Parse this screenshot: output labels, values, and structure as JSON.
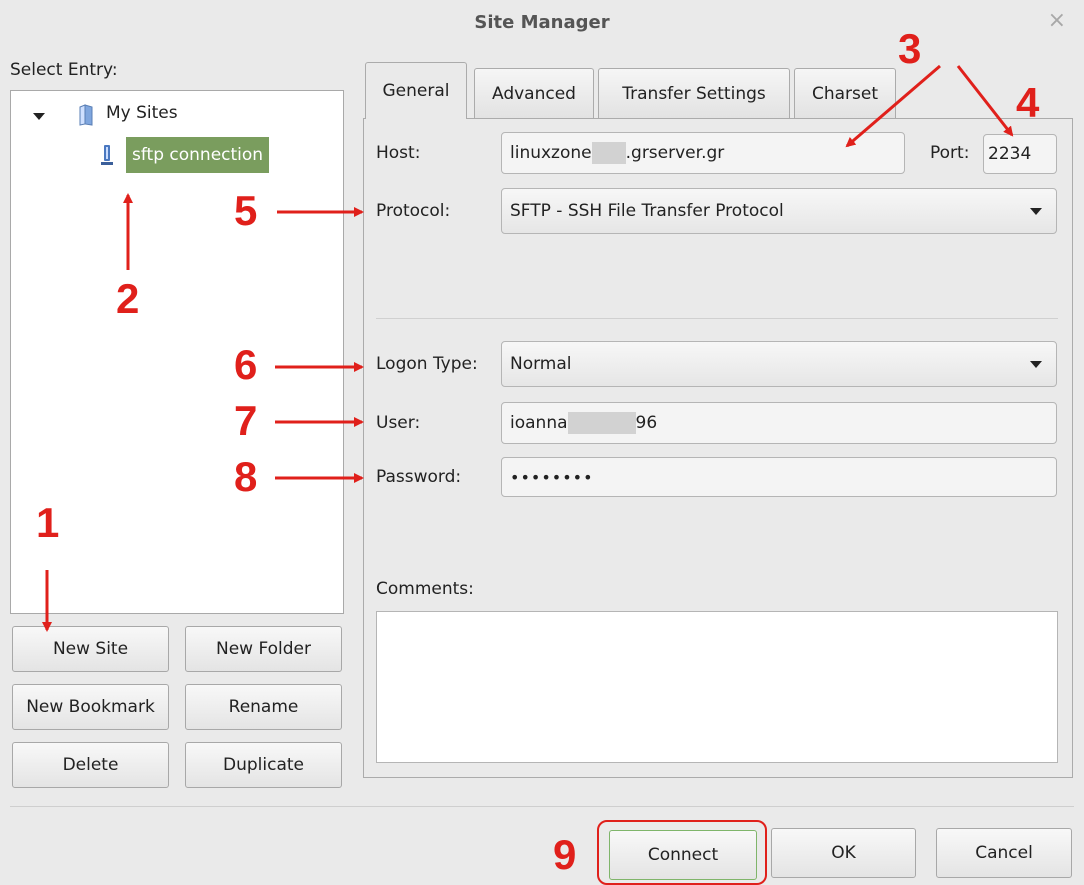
{
  "window": {
    "title": "Site Manager",
    "close_glyph": "×"
  },
  "left": {
    "select_entry_label": "Select Entry:",
    "tree": {
      "root_label": "My Sites",
      "site_label": "sftp connection"
    },
    "buttons": {
      "new_site": "New Site",
      "new_folder": "New Folder",
      "new_bookmark": "New Bookmark",
      "rename": "Rename",
      "delete": "Delete",
      "duplicate": "Duplicate"
    }
  },
  "tabs": [
    "General",
    "Advanced",
    "Transfer Settings",
    "Charset"
  ],
  "general": {
    "host_label": "Host:",
    "host_value_prefix": "linuxzone",
    "host_value_suffix": ".grserver.gr",
    "port_label": "Port:",
    "port_value": "2234",
    "protocol_label": "Protocol:",
    "protocol_value": "SFTP - SSH File Transfer Protocol",
    "logon_type_label": "Logon Type:",
    "logon_type_value": "Normal",
    "user_label": "User:",
    "user_value_prefix": "ioanna",
    "user_value_suffix": "96",
    "password_label": "Password:",
    "password_value": "••••••••",
    "comments_label": "Comments:"
  },
  "footer": {
    "connect": "Connect",
    "ok": "OK",
    "cancel": "Cancel"
  },
  "annotations": {
    "n1": "1",
    "n2": "2",
    "n3": "3",
    "n4": "4",
    "n5": "5",
    "n6": "6",
    "n7": "7",
    "n8": "8",
    "n9": "9"
  },
  "colors": {
    "annotation": "#e0201b",
    "selection": "#7a9d5e",
    "window_bg": "#eaeaea"
  }
}
